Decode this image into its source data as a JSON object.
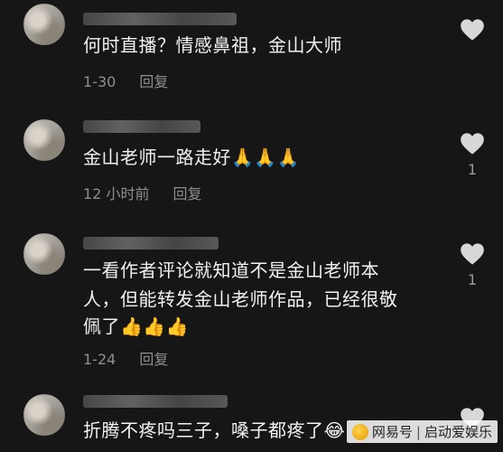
{
  "comments": [
    {
      "text": "何时直播？情感鼻祖，金山大师",
      "time": "1-30",
      "reply_label": "回复",
      "like_count": ""
    },
    {
      "text": "金山老师一路走好🙏🙏🙏",
      "time": "12 小时前",
      "reply_label": "回复",
      "like_count": "1"
    },
    {
      "text_lines": [
        "一看作者评论就知道不是金山老师本",
        "人，但能转发金山老师作品，已经很敬",
        "佩了👍👍👍"
      ],
      "time": "1-24",
      "reply_label": "回复",
      "like_count": "1"
    },
    {
      "text": "折腾不疼吗三子，嗓子都疼了😂",
      "time": "",
      "reply_label": "",
      "like_count": ""
    }
  ],
  "watermark": {
    "source": "网易号",
    "author": "启动爱娱乐"
  },
  "icons": {
    "like": "heart-icon",
    "watermark_logo": "netease-logo-icon"
  },
  "colors": {
    "background": "#161616",
    "text": "#f2f2f2",
    "meta": "#8e8e8e",
    "heart": "#d8d8d8"
  }
}
